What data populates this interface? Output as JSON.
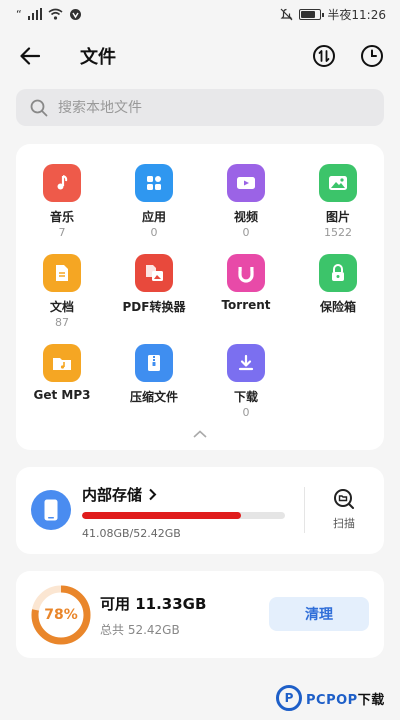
{
  "status_bar": {
    "time": "半夜11:26",
    "signal": "“",
    "icons": [
      "signal-icon",
      "wifi-icon",
      "notification-icon",
      "mute-icon",
      "battery-icon"
    ]
  },
  "app_bar": {
    "title": "文件",
    "back_icon": "back-arrow-icon",
    "actions": [
      "sort-icon",
      "recent-clock-icon"
    ]
  },
  "search": {
    "placeholder": "搜索本地文件"
  },
  "categories": [
    {
      "label": "音乐",
      "count": "7",
      "icon": "music-icon",
      "color": "#ee5a4a"
    },
    {
      "label": "应用",
      "count": "0",
      "icon": "apps-icon",
      "color": "#2f97f0"
    },
    {
      "label": "视频",
      "count": "0",
      "icon": "video-icon",
      "color": "#9b63e6"
    },
    {
      "label": "图片",
      "count": "1522",
      "icon": "image-icon",
      "color": "#3cc46a"
    },
    {
      "label": "文档",
      "count": "87",
      "icon": "document-icon",
      "color": "#f5a623"
    },
    {
      "label": "PDF转换器",
      "count": "",
      "icon": "pdf-converter-icon",
      "color": "#e8493c"
    },
    {
      "label": "Torrent",
      "count": "",
      "icon": "torrent-icon",
      "color": "#e84aa8"
    },
    {
      "label": "保险箱",
      "count": "",
      "icon": "safe-icon",
      "color": "#3cc46a"
    },
    {
      "label": "Get MP3",
      "count": "",
      "icon": "get-mp3-icon",
      "color": "#f5a623"
    },
    {
      "label": "压缩文件",
      "count": "",
      "icon": "zip-icon",
      "color": "#3f8ef0"
    },
    {
      "label": "下载",
      "count": "0",
      "icon": "download-icon",
      "color": "#7b6ff0"
    }
  ],
  "storage": {
    "title": "内部存储",
    "used_text": "41.08GB/52.42GB",
    "used_fraction": 0.784,
    "scan_label": "扫描"
  },
  "available": {
    "percent_text": "78%",
    "percent": 78,
    "title": "可用 11.33GB",
    "total_text": "总共 52.42GB",
    "clean_label": "清理"
  },
  "watermark": {
    "brand": "PCPOP",
    "suffix": "下载"
  },
  "colors": {
    "accent": "#2f6ed8",
    "storage_bar": "#e01c1c",
    "ring": "#e9862b"
  }
}
